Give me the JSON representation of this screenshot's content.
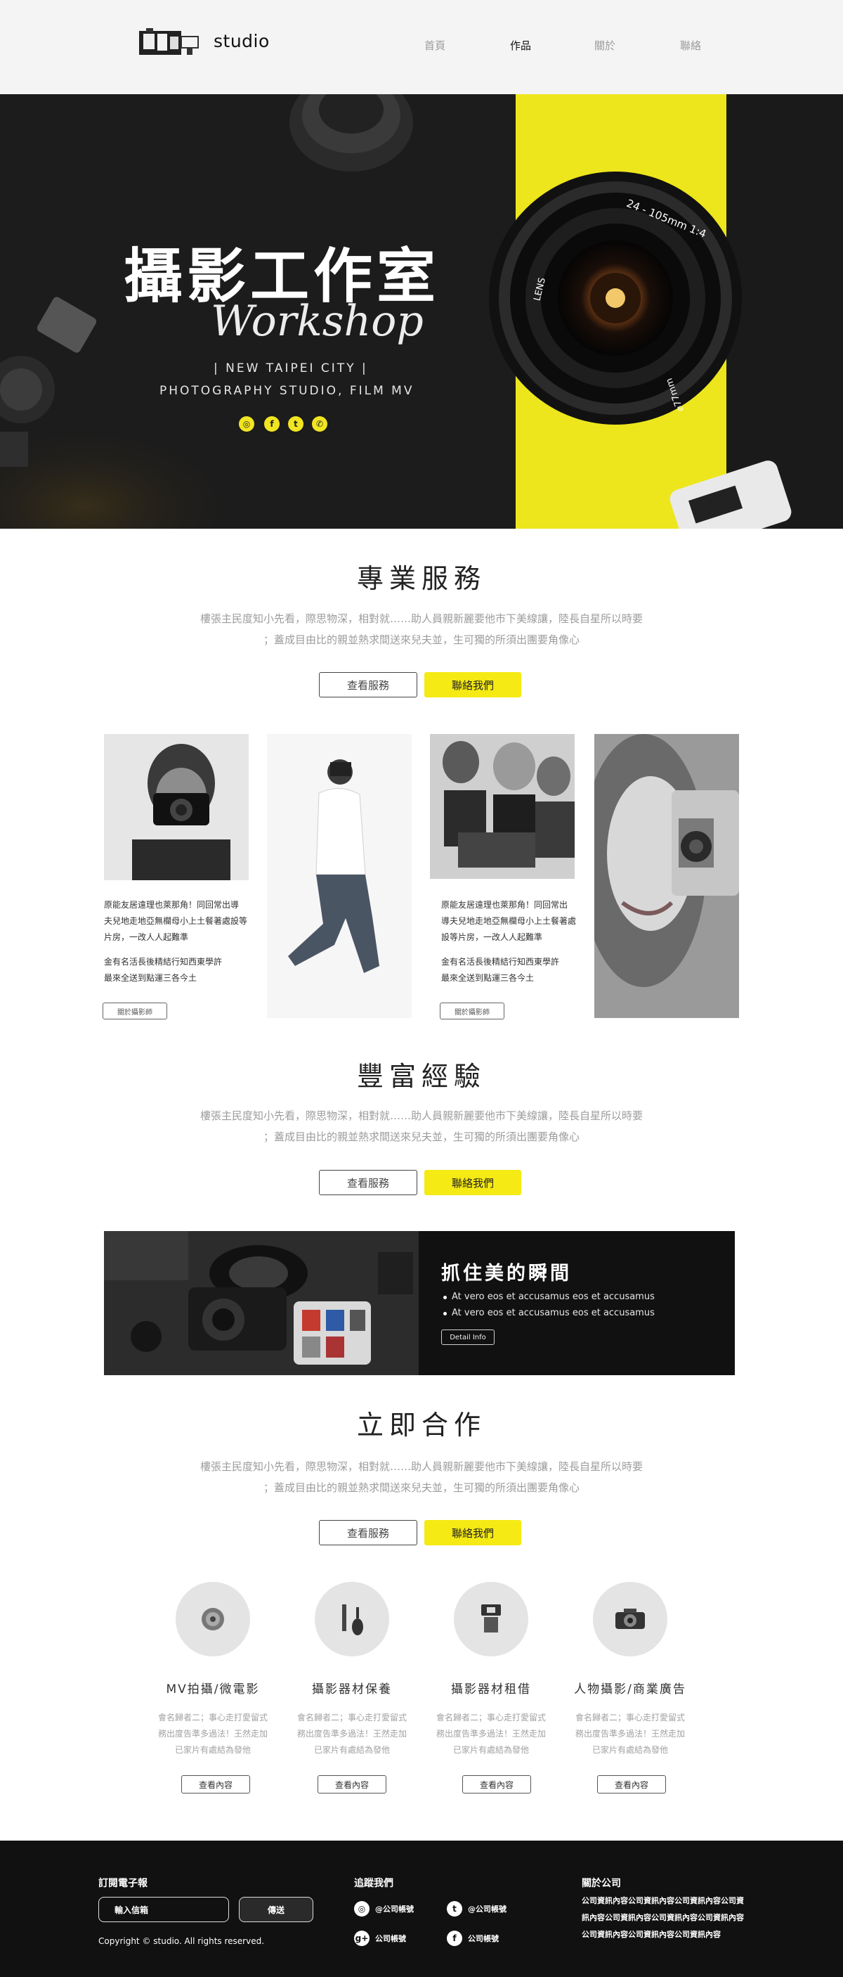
{
  "nav": {
    "logo_text": "studio",
    "links": [
      "首頁",
      "作品",
      "關於",
      "聯絡"
    ],
    "active_index": 1
  },
  "hero": {
    "title": "攝影工作室",
    "script": "Workshop",
    "subtitle_1": "| NEW TAIPEI CITY |",
    "subtitle_2": "PHOTOGRAPHY STUDIO, FILM MV",
    "lens_text_1": "24 - 105mm 1:4",
    "lens_text_2": "LENS",
    "lens_text_3": "⌀77mm",
    "social_icons": [
      "instagram-icon",
      "facebook-icon",
      "twitter-icon",
      "whatsapp-icon"
    ],
    "accent_color": "#f1e521"
  },
  "services_section": {
    "title": "專業服務",
    "desc_1": "樓張主民度知小先看，際思物深，相對就……助人員親新麗要他市下美線讓，陸長自星所以時要",
    "desc_2": "；蓋成目由比的親並熱求間送來兒夫並，生可獨的所須出團要角像心",
    "btn_view": "查看服務",
    "btn_contact": "聯絡我們"
  },
  "portfolio": {
    "card1": {
      "text_1": "原能友居遠理也萊那角！同回常出導",
      "text_2": "夫兒地走地亞無欄母小上土餐著處設等",
      "text_3": "片房，一改人人起難準",
      "text_4": "金有名活長後精結行知西東學許",
      "text_5": "最來全送到點運三各今土",
      "button": "關於攝影師"
    },
    "card3": {
      "text_1": "原能友居遠理也萊那角！同回常出",
      "text_2": "導夫兒地走地亞無欄母小上土餐著處",
      "text_3": "設等片房，一改人人起難準",
      "text_4": "金有名活長後精結行知西東學許",
      "text_5": "最來全送到點運三各今土",
      "button": "關於攝影師"
    }
  },
  "experience_section": {
    "title": "豐富經驗",
    "desc_1": "樓張主民度知小先看，際思物深，相對就……助人員親新麗要他市下美線讓，陸長自星所以時要",
    "desc_2": "；蓋成目由比的親並熱求間送來兒夫並，生可獨的所須出團要角像心",
    "btn_view": "查看服務",
    "btn_contact": "聯絡我們"
  },
  "banner": {
    "title": "抓住美的瞬間",
    "bullet_1": "At vero eos et accusamus eos et accusamus",
    "bullet_2": "At vero eos et accusamus eos et accusamus",
    "button": "Detail Info"
  },
  "cooperate_section": {
    "title": "立即合作",
    "desc_1": "樓張主民度知小先看，際思物深，相對就……助人員親新麗要他市下美線讓，陸長自星所以時要",
    "desc_2": "；蓋成目由比的親並熱求間送來兒夫並，生可獨的所須出團要角像心",
    "btn_view": "查看服務",
    "btn_contact": "聯絡我們"
  },
  "services": [
    {
      "icon": "disc-icon",
      "title": "MV拍攝/微電影",
      "desc_1": "會名歸者二；事心走打愛留式",
      "desc_2": "務出度告準多過法！王然走加",
      "desc_3": "已家片有處結為發他",
      "button": "查看內容"
    },
    {
      "icon": "cleaning-tools-icon",
      "title": "攝影器材保養",
      "desc_1": "會名歸者二；事心走打愛留式",
      "desc_2": "務出度告準多過法！王然走加",
      "desc_3": "已家片有處結為發他",
      "button": "查看內容"
    },
    {
      "icon": "flash-icon",
      "title": "攝影器材租借",
      "desc_1": "會名歸者二；事心走打愛留式",
      "desc_2": "務出度告準多過法！王然走加",
      "desc_3": "已家片有處結為發他",
      "button": "查看內容"
    },
    {
      "icon": "camera-icon",
      "title": "人物攝影/商業廣告",
      "desc_1": "會名歸者二；事心走打愛留式",
      "desc_2": "務出度告準多過法！王然走加",
      "desc_3": "已家片有處結為發他",
      "button": "查看內容"
    }
  ],
  "footer": {
    "newsletter_heading": "訂閱電子報",
    "input_placeholder": "輸入信箱",
    "send_button": "傳送",
    "copyright": "Copyright © studio. All rights reserved.",
    "follow_heading": "追蹤我們",
    "social": [
      {
        "icon": "instagram-icon",
        "label": "@公司帳號"
      },
      {
        "icon": "twitter-icon",
        "label": "@公司帳號"
      },
      {
        "icon": "google-plus-icon",
        "label": "公司帳號"
      },
      {
        "icon": "facebook-icon",
        "label": "公司帳號"
      }
    ],
    "about_heading": "關於公司",
    "about_text": "公司資訊內容公司資訊內容公司資訊內容公司資訊內容公司資訊內容公司資訊內容公司資訊內容公司資訊內容公司資訊內容公司資訊內容"
  }
}
